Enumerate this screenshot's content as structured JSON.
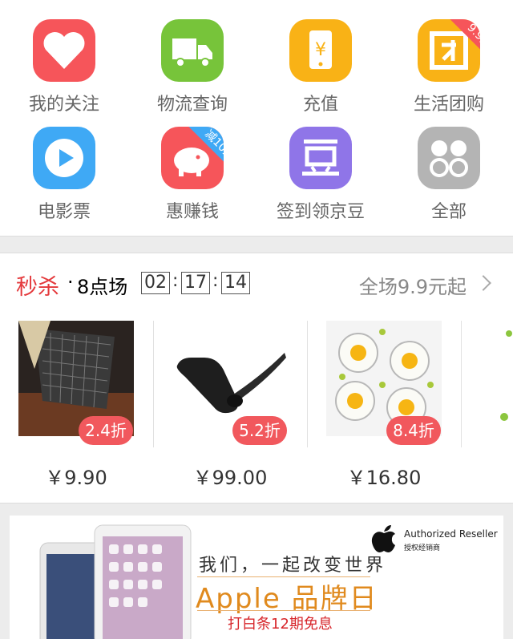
{
  "quick_icons": [
    {
      "label": "我的关注",
      "icon": "heart-icon",
      "color": "#f6555a"
    },
    {
      "label": "物流查询",
      "icon": "truck-icon",
      "color": "#77c43a"
    },
    {
      "label": "充值",
      "icon": "phone-yuan-icon",
      "color": "#f9b216"
    },
    {
      "label": "生活团购",
      "icon": "group-buy-icon",
      "color": "#f9b216",
      "badge": "9.9元"
    },
    {
      "label": "电影票",
      "icon": "play-icon",
      "color": "#3fa9f5"
    },
    {
      "label": "惠赚钱",
      "icon": "piggy-bank-icon",
      "color": "#f6555a",
      "badge": "减10元"
    },
    {
      "label": "签到领京豆",
      "icon": "bean-icon",
      "color": "#8f75e8"
    },
    {
      "label": "全部",
      "icon": "all-circles-icon",
      "color": "#b4b4b4"
    }
  ],
  "flash_sale": {
    "title": "秒杀",
    "dot": "·",
    "session": "8点场",
    "countdown": {
      "h": "02",
      "m": "17",
      "s": "14",
      "sep": ":"
    },
    "more": "全场9.9元起",
    "products": [
      {
        "name": "seat-cushion",
        "discount": "2.4折",
        "price": "￥9.90"
      },
      {
        "name": "bluetooth-headset",
        "discount": "5.2折",
        "price": "￥99.00"
      },
      {
        "name": "egg-mold",
        "discount": "8.4折",
        "price": "￥16.80"
      },
      {
        "name": "partial-item",
        "discount": "",
        "price": "￥"
      }
    ]
  },
  "banner": {
    "authorized": "Authorized Reseller",
    "authorized_cn": "授权经销商",
    "line1": "我们，一起改变世界",
    "line2": "Apple 品牌日",
    "line3": "打白条12期免息"
  },
  "colors": {
    "accent": "#e4393c",
    "discount": "#f1585d",
    "apple_orange": "#e08a1e"
  }
}
